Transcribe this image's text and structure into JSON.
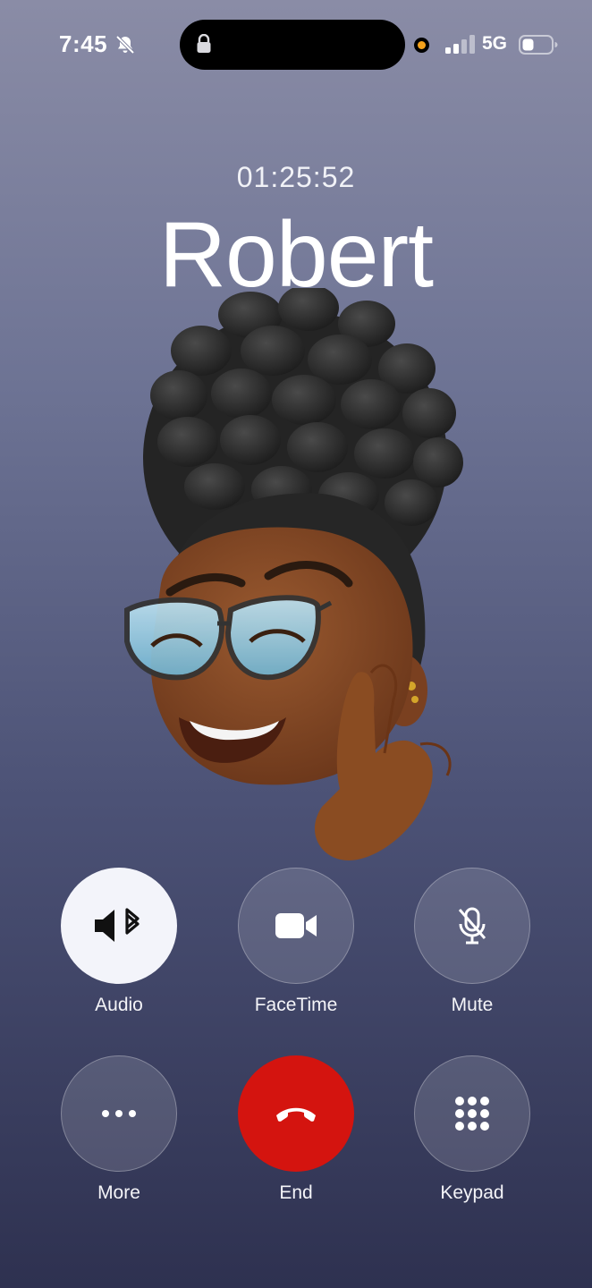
{
  "status_bar": {
    "time": "7:45",
    "network": "5G",
    "icons": [
      "bell-slash-icon",
      "lock-icon",
      "privacy-indicator-orange",
      "signal-icon",
      "battery-icon"
    ],
    "privacy_dot_color": "#f5a21c"
  },
  "call": {
    "timer": "01:25:52",
    "caller_name": "Robert",
    "avatar": "memoji-crossed-fingers"
  },
  "controls": [
    {
      "label": "Audio",
      "icon": "speaker-bluetooth-icon",
      "active": true
    },
    {
      "label": "FaceTime",
      "icon": "video-camera-icon",
      "active": false
    },
    {
      "label": "Mute",
      "icon": "mic-slash-icon",
      "active": false
    },
    {
      "label": "More",
      "icon": "ellipsis-icon",
      "active": false
    },
    {
      "label": "End",
      "icon": "phone-down-icon",
      "color": "#d4140f"
    },
    {
      "label": "Keypad",
      "icon": "keypad-icon",
      "active": false
    }
  ]
}
